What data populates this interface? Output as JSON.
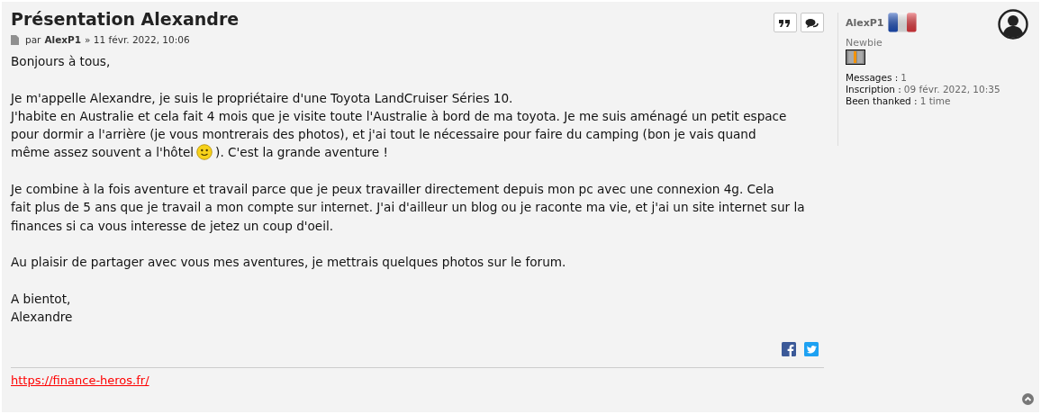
{
  "post": {
    "title": "Présentation Alexandre",
    "byline": {
      "prefix": "par",
      "author": "AlexP1",
      "date": "» 11 févr. 2022, 10:06"
    },
    "actions": [
      {
        "kind": "quote"
      },
      {
        "kind": "reply"
      }
    ],
    "paragraphs": [
      {
        "lines": [
          [
            {
              "text": "Bonjours à tous,"
            }
          ]
        ]
      },
      {
        "lines": [
          [
            {
              "text": "Je m'appelle Alexandre, je suis le propriétaire d'une Toyota LandCruiser Séries 10."
            }
          ],
          [
            {
              "text": "J'habite en Australie et cela fait 4 mois que je visite toute l'Australie à bord de ma toyota. Je me suis aménagé un petit espace"
            }
          ],
          [
            {
              "text": "pour dormir a l'arrière (je vous montrerais des photos), et j'ai tout le nécessaire pour faire du camping (bon je vais quand"
            }
          ],
          [
            {
              "text": "même assez souvent a l'hôtel"
            },
            {
              "kind": "smiley"
            },
            {
              "text": "). C'est la grande aventure !"
            }
          ]
        ]
      },
      {
        "lines": [
          [
            {
              "text": "Je combine à la fois aventure et travail parce que je peux travailler directement depuis mon pc avec une connexion 4g. Cela"
            }
          ],
          [
            {
              "text": "fait plus de 5 ans que je travail a mon compte sur internet. J'ai d'ailleur un blog ou je raconte ma vie, et j'ai un site internet sur la"
            }
          ],
          [
            {
              "text": "finances si ca vous interesse de jetez un coup d'oeil."
            }
          ]
        ]
      },
      {
        "lines": [
          [
            {
              "text": "Au plaisir de partager avec vous mes aventures, je mettrais quelques photos sur le forum."
            }
          ]
        ]
      },
      {
        "lines": [
          [
            {
              "text": "A bientot,"
            }
          ],
          [
            {
              "text": "Alexandre"
            }
          ]
        ]
      }
    ],
    "share": [
      {
        "kind": "facebook"
      },
      {
        "kind": "twitter"
      }
    ],
    "signature": "https://finance-heros.fr/"
  },
  "profile": {
    "username": "AlexP1",
    "rank": "Newbie",
    "stats": [
      {
        "label": "Messages :",
        "value": "1"
      },
      {
        "label": "Inscription :",
        "value": "09 févr. 2022, 10:35"
      },
      {
        "label": "Been thanked :",
        "value": "1 time"
      }
    ]
  }
}
